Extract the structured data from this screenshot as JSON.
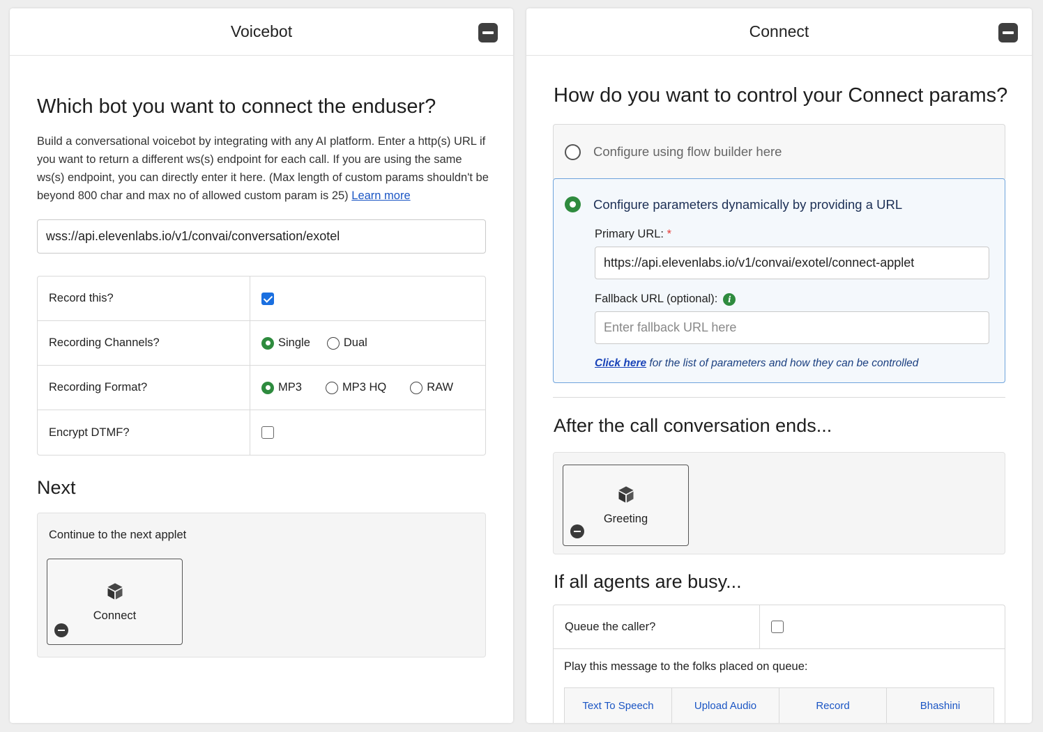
{
  "voicebot_panel": {
    "title": "Voicebot",
    "heading": "Which bot you want to connect the enduser?",
    "description": "Build a conversational voicebot by integrating with any AI platform. Enter a http(s) URL if you want to return a different ws(s) endpoint for each call. If you are using the same ws(s) endpoint, you can directly enter it here. (Max length of custom params shouldn't be beyond 800 char and max no of allowed custom param is 25)",
    "learn_more_label": "Learn more",
    "url_value": "wss://api.elevenlabs.io/v1/convai/conversation/exotel",
    "options": {
      "record_label": "Record this?",
      "record_checked": true,
      "channels_label": "Recording Channels?",
      "channels": [
        "Single",
        "Dual"
      ],
      "channels_selected": "Single",
      "format_label": "Recording Format?",
      "formats": [
        "MP3",
        "MP3 HQ",
        "RAW"
      ],
      "format_selected": "MP3",
      "encrypt_label": "Encrypt DTMF?",
      "encrypt_checked": false
    },
    "next_heading": "Next",
    "next_description": "Continue to the next applet",
    "next_applet_label": "Connect"
  },
  "connect_panel": {
    "title": "Connect",
    "heading": "How do you want to control your Connect params?",
    "option_flow_builder": "Configure using flow builder here",
    "option_dynamic": "Configure parameters dynamically by providing a URL",
    "selected_option": "dynamic",
    "primary_url_label": "Primary URL:",
    "primary_url_required": "*",
    "primary_url_value": "https://api.elevenlabs.io/v1/convai/exotel/connect-applet",
    "fallback_url_label": "Fallback URL (optional):",
    "fallback_url_placeholder": "Enter fallback URL here",
    "hint_link": "Click here",
    "hint_text": " for the list of parameters and how they can be controlled",
    "after_call_heading": "After the call conversation ends...",
    "after_call_applet_label": "Greeting",
    "busy_heading": "If all agents are busy...",
    "queue_label": "Queue the caller?",
    "queue_checked": false,
    "queue_message_label": "Play this message to the folks placed on queue:",
    "tabs": [
      "Text To Speech",
      "Upload Audio",
      "Record",
      "Bhashini"
    ]
  },
  "colors": {
    "accent_blue": "#1a55c4",
    "radio_green": "#2e8b3e",
    "checkbox_blue": "#1a6fe0",
    "selected_box_border": "#6ea3dc"
  }
}
